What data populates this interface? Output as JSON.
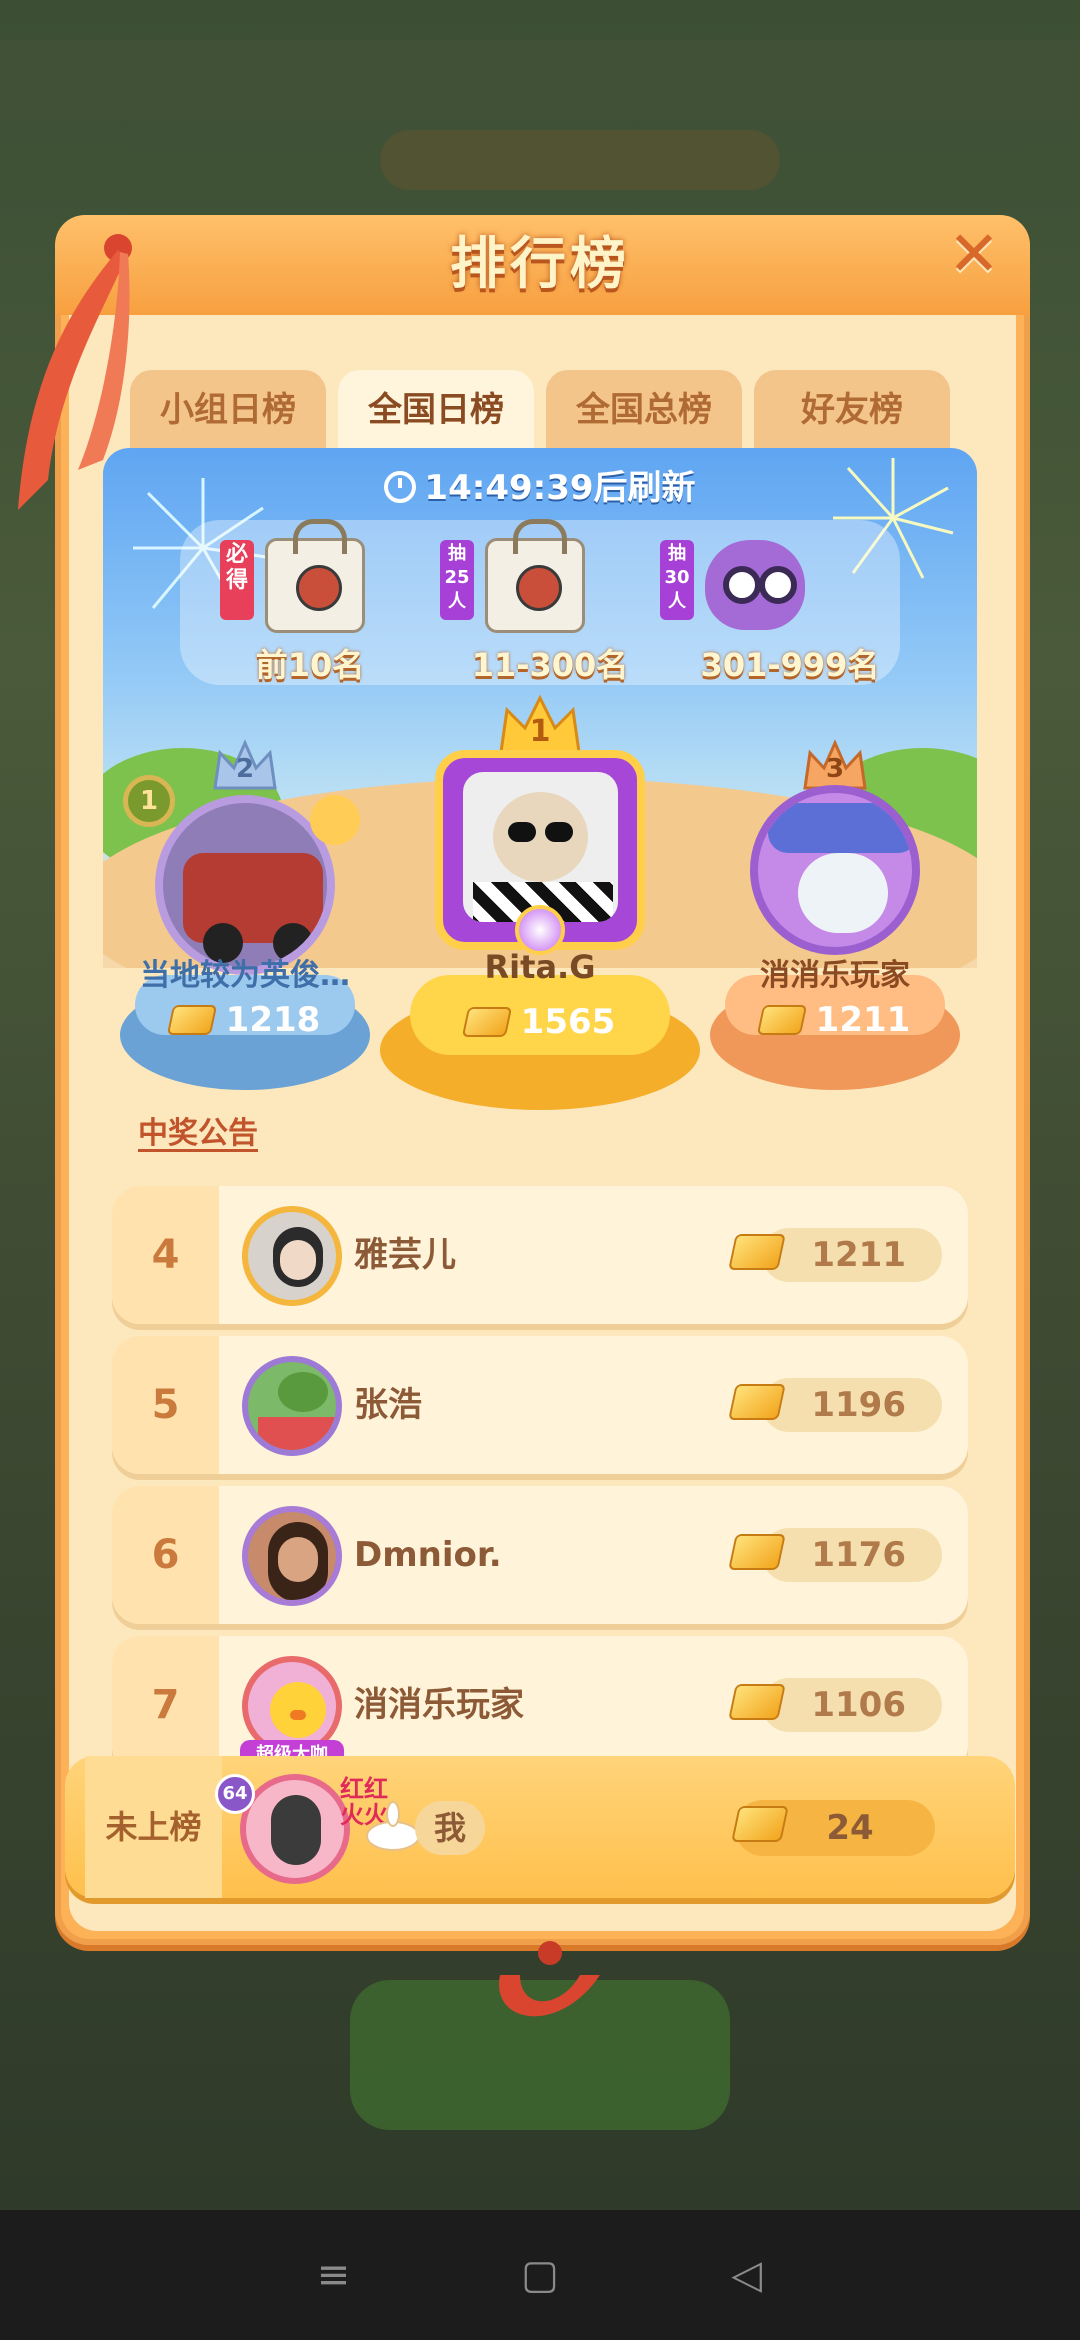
{
  "header": {
    "title": "排行榜"
  },
  "tabs": [
    {
      "label": "小组日榜",
      "active": false
    },
    {
      "label": "全国日榜",
      "active": true
    },
    {
      "label": "全国总榜",
      "active": false
    },
    {
      "label": "好友榜",
      "active": false
    }
  ],
  "timer": {
    "text": "14:49:39后刷新"
  },
  "rewards": [
    {
      "tag": "必得",
      "label": "前10名",
      "icon": "bag-icon"
    },
    {
      "tag": "抽25人",
      "label": "11-300名",
      "icon": "bag-icon"
    },
    {
      "tag": "抽30人",
      "label": "301-999名",
      "icon": "owl-plush-icon"
    }
  ],
  "podium": {
    "first": {
      "rank": "1",
      "name": "Rita.G",
      "score": "1565"
    },
    "second": {
      "rank": "2",
      "name": "当地较为英俊…",
      "score": "1218",
      "badge": "1"
    },
    "third": {
      "rank": "3",
      "name": "消消乐玩家",
      "score": "1211"
    }
  },
  "announcement": "中奖公告",
  "list": [
    {
      "rank": "4",
      "name": "雅芸儿",
      "score": "1211"
    },
    {
      "rank": "5",
      "name": "张浩",
      "score": "1196"
    },
    {
      "rank": "6",
      "name": "Dmnior.",
      "score": "1176"
    },
    {
      "rank": "7",
      "name": "消消乐玩家",
      "score": "1106",
      "badge": "超级大咖"
    }
  ],
  "me": {
    "status": "未上榜",
    "level": "64",
    "name": "我",
    "score": "24",
    "frame_text": "红红火火"
  },
  "colors": {
    "panel": "#fdb257",
    "panel_inner": "#fde7bd",
    "blue": "#5fa5f2",
    "gold": "#f2a51d"
  }
}
